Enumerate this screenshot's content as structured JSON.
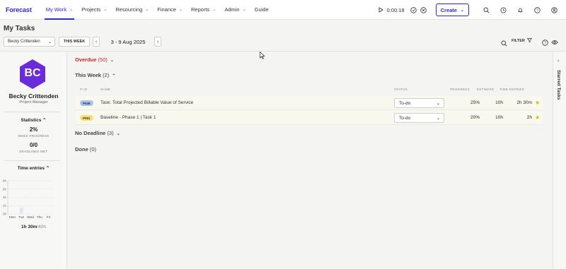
{
  "app": {
    "logo": "Forecast"
  },
  "nav": [
    {
      "label": "My Work",
      "active": true
    },
    {
      "label": "Projects"
    },
    {
      "label": "Resourcing"
    },
    {
      "label": "Finance"
    },
    {
      "label": "Reports"
    },
    {
      "label": "Admin"
    },
    {
      "label": "Guide"
    }
  ],
  "topbar": {
    "timer": "0:00:18",
    "create_label": "Create",
    "icons": [
      "play-icon",
      "check-circle-icon",
      "close-circle-icon",
      "search-icon",
      "clock-icon",
      "bell-icon",
      "help-icon",
      "user-icon"
    ]
  },
  "page": {
    "title": "My Tasks"
  },
  "toolbar": {
    "person": "Becky Crittenden",
    "week_button": "THIS WEEK",
    "date_range": "3 - 9 Aug 2025",
    "filter_label": "FILTER"
  },
  "sidebar": {
    "initials": "BC",
    "name": "Becky Crittenden",
    "role": "Project Manager",
    "statistics_label": "Statistics",
    "week_progress_value": "2%",
    "week_progress_label": "WEEK PROGRESS",
    "deadlines_value": "0/0",
    "deadlines_label": "DEADLINES MET",
    "time_entries_label": "Time entries",
    "time_total": "1h 30m",
    "time_target": "/40h",
    "chart_ticks": [
      "8h",
      "6h",
      "4h",
      "2h",
      "0h"
    ],
    "chart_days": [
      "Mon",
      "Tue",
      "Wed",
      "Thu",
      "Fri"
    ]
  },
  "chart_data": {
    "type": "bar",
    "categories": [
      "Mon",
      "Tue",
      "Wed",
      "Thu",
      "Fri"
    ],
    "values": [
      0,
      1.5,
      0,
      0,
      0
    ],
    "ylim": [
      0,
      8
    ],
    "ylabel": "",
    "xlabel": ""
  },
  "groups": {
    "overdue": {
      "label": "Overdue",
      "count": "(50)"
    },
    "this_week": {
      "label": "This Week",
      "count": "(2)"
    },
    "no_deadline": {
      "label": "No Deadline",
      "count": "(3)"
    },
    "done": {
      "label": "Done",
      "count": "(0)"
    }
  },
  "table": {
    "headers": {
      "pid": "P-ID",
      "name": "NAME",
      "status": "STATUS",
      "progress": "PROGRESS",
      "estimate": "ESTIMATE",
      "time": "TIME ENTRIES"
    },
    "rows": [
      {
        "pid": "P046",
        "tag_color": "#a8c4f0",
        "name": "Task: Total Projected Billable Value of Service",
        "status": "To-do",
        "progress": "25%",
        "estimate": "10h",
        "time": "2h 30m"
      },
      {
        "pid": "P051",
        "tag_color": "#f5e17a",
        "name": "Baseline - Phase 1 | Task 1",
        "status": "To-do",
        "progress": "20%",
        "estimate": "10h",
        "time": "2h"
      }
    ]
  },
  "starred_panel": {
    "label": "Starred Tasks"
  },
  "colors": {
    "accent": "#2b2be0",
    "overdue": "#c62828",
    "avatar": "#6a2bd9",
    "star": "#e2b400"
  }
}
